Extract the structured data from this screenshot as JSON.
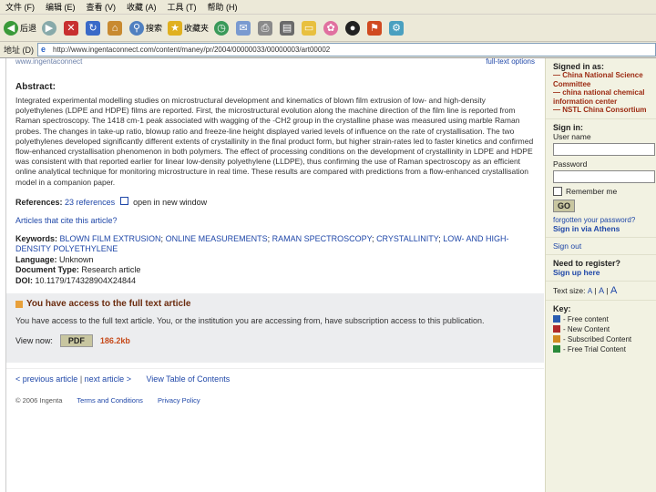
{
  "browser": {
    "menus": [
      "文件 (F)",
      "编辑 (E)",
      "查看 (V)",
      "收藏 (A)",
      "工具 (T)",
      "帮助 (H)"
    ],
    "toolbar": {
      "back_label": "后退",
      "search_label": "搜索",
      "favorites_label": "收藏夹"
    },
    "address": {
      "label": "地址 (D)",
      "url": "http://www.ingentaconnect.com/content/maney/pr/2004/00000033/00000003/art00002"
    }
  },
  "header_stub": {
    "left": "www.ingentaconnect",
    "right": "full-text options"
  },
  "abstract": {
    "heading": "Abstract:",
    "text": "Integrated experimental modelling studies on microstructural development and kinematics of blown film extrusion of low- and high-density polyethylenes (LDPE and HDPE) films are reported. First, the microstructural evolution along the machine direction of the film line is reported from Raman spectroscopy. The 1418 cm-1 peak associated with wagging of the -CH2 group in the crystalline phase was measured using marble Raman probes. The changes in take-up ratio, blowup ratio and freeze-line height displayed varied levels of influence on the rate of crystallisation. The two polyethylenes developed significantly different extents of crystallinity in the final product form, but higher strain-rates led to faster kinetics and confirmed flow-enhanced crystallisation phenomenon in both polymers. The effect of processing conditions on the development of crystallinity in LDPE and HDPE was consistent with that reported earlier for linear low-density polyethylene (LLDPE), thus confirming the use of Raman spectroscopy as an efficient online analytical technique for monitoring microstructure in real time. These results are compared with predictions from a flow-enhanced crystallisation model in a companion paper."
  },
  "references": {
    "label": "References:",
    "count_link": "23 references",
    "window_link": "open in new window"
  },
  "cited": {
    "link": "Articles that cite this article?"
  },
  "meta": {
    "keywords_label": "Keywords:",
    "keywords": [
      "BLOWN FILM EXTRUSION",
      "ONLINE MEASUREMENTS",
      "RAMAN SPECTROSCOPY",
      "CRYSTALLINITY",
      "LOW- AND HIGH-DENSITY POLYETHYLENE"
    ],
    "language_label": "Language:",
    "language": "Unknown",
    "doctype_label": "Document Type:",
    "doctype": "Research article",
    "doi_label": "DOI:",
    "doi": "10.1179/174328904X24844"
  },
  "access": {
    "heading": "You have access to the full text article",
    "text": "You have access to the full text article. You, or the institution you are accessing from, have subscription access to this publication.",
    "view_label": "View now:",
    "pdf_button": "PDF",
    "size": "186.2kb"
  },
  "nav": {
    "prev": "< previous article",
    "sep": "|",
    "next": "next article >",
    "toc": "View Table of Contents"
  },
  "footer": {
    "copyright": "© 2006 Ingenta",
    "terms": "Terms and Conditions",
    "privacy": "Privacy Policy"
  },
  "sidebar": {
    "signed_in_label": "Signed in as:",
    "orgs": [
      "China National Science Committee",
      "china national chemical information center",
      "NSTL China Consortium"
    ],
    "signin_heading": "Sign in:",
    "username_label": "User name",
    "password_label": "Password",
    "remember_label": "Remember me",
    "go_button": "GO",
    "forgot_link": "forgotten your password?",
    "athens_link": "Sign in via Athens",
    "signout_link": "Sign out",
    "register_prompt": "Need to register?",
    "register_link": "Sign up here",
    "textsize_label": "Text size:",
    "textsize_options": [
      "A",
      "A",
      "A"
    ],
    "key_heading": "Key:",
    "key_items": [
      {
        "symbol": "F",
        "label": "- Free content",
        "color": "#2a5db0"
      },
      {
        "symbol": "N",
        "label": "- New Content",
        "color": "#b02a2a"
      },
      {
        "symbol": "S",
        "label": "- Subscribed Content",
        "color": "#d08a20"
      },
      {
        "symbol": "T",
        "label": "- Free Trial Content",
        "color": "#2a8a3a"
      }
    ]
  }
}
